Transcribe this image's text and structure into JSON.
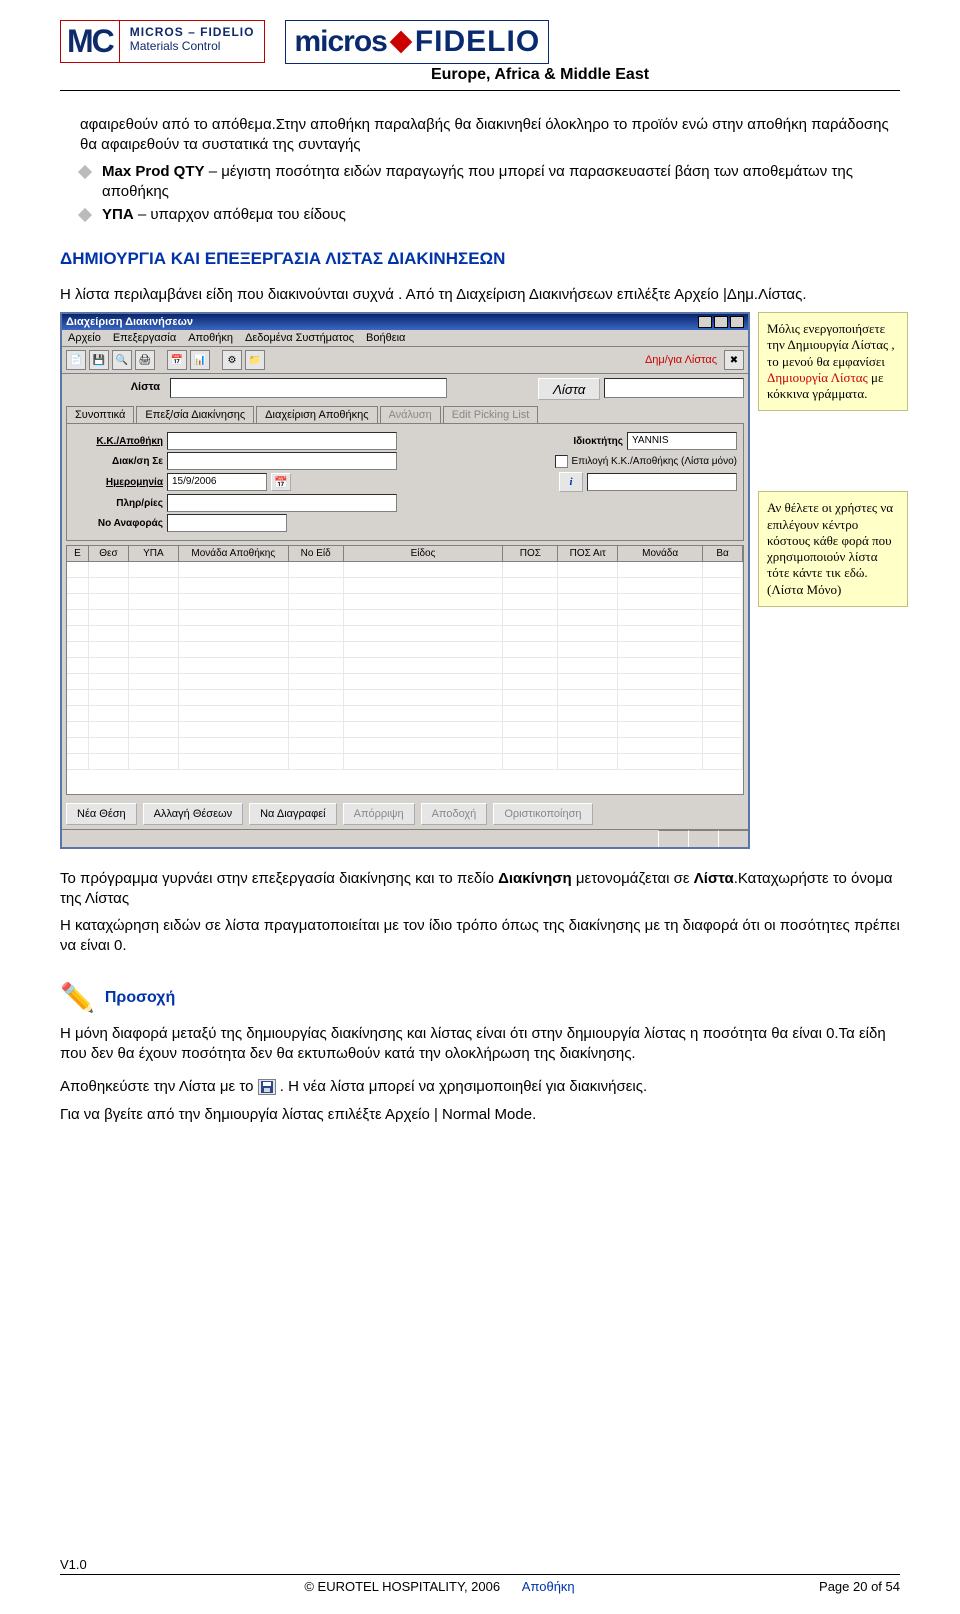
{
  "header": {
    "mc": "MC",
    "mc_line1": "MICROS – FIDELIO",
    "mc_line2": "Materials Control",
    "mf_left": "micros",
    "mf_right": "FIDELIO",
    "subtitle": "Europe, Africa & Middle East"
  },
  "intro_text": "αφαιρεθούν από το απόθεμα.Στην αποθήκη παραλαβής θα διακινηθεί όλοκληρο το προϊόν ενώ στην αποθήκη παράδοσης θα αφαιρεθούν τα συστατικά της συνταγής",
  "bullets": [
    {
      "bold": "Max Prod QTY",
      "rest": " – μέγιστη ποσότητα ειδών παραγωγής που μπορεί να παρασκευαστεί βάση των αποθεμάτων της αποθήκης"
    },
    {
      "bold": "ΥΠΑ",
      "rest": " – υπαρχον απόθεμα του είδους"
    }
  ],
  "section_title": "ΔΗΜΙΟΥΡΓΙΑ ΚΑΙ ΕΠΕΞΕΡΓΑΣΙΑ ΛΙΣΤΑΣ ΔΙΑΚΙΝΗΣΕΩΝ",
  "section_intro": "Η λίστα περιλαμβάνει είδη που διακινούνται συχνά . Από τη Διαχείριση Διακινήσεων επιλέξτε Αρχείο |Δημ.Λίστας.",
  "app": {
    "title": "Διαχείριση Διακινήσεων",
    "menu": [
      "Αρχείο",
      "Επεξεργασία",
      "Αποθήκη",
      "Δεδομένα Συστήματος",
      "Βοήθεια"
    ],
    "red_link": "Δημ/για Λίστας",
    "lista_label": "Λίστα",
    "lista_btn": "Λίστα",
    "tabs": [
      "Συνοπτικά",
      "Επεξ/σία Διακίνησης",
      "Διαχείριση Αποθήκης",
      "Ανάλυση",
      "Edit Picking List"
    ],
    "form": {
      "row1_label": "Κ.Κ./Αποθήκη",
      "row1_right_label": "Ιδιοκτήτης",
      "row1_right_value": "YANNIS",
      "row2_label": "Διακ/ση Σε",
      "row2_check": "Επιλογή Κ.Κ./Αποθήκης (Λίστα μόνο)",
      "row3_label": "Ημερομηνία",
      "row3_value": "15/9/2006",
      "row4_label": "Πληρ/ρίες",
      "row5_label": "Νο Αναφοράς"
    },
    "grid_headers": [
      "Ε",
      "Θεσ",
      "ΥΠΑ",
      "Μονάδα Αποθήκης",
      "Νο Είδ",
      "Είδος",
      "ΠΟΣ",
      "ΠΟΣ Αιτ",
      "Μονάδα",
      "Βα"
    ],
    "footer_buttons": [
      "Νέα Θέση",
      "Αλλαγή Θέσεων",
      "Να Διαγραφεί",
      "Απόρριψη",
      "Αποδοχή",
      "Οριστικοποίηση"
    ]
  },
  "callouts": [
    {
      "pre": "Μόλις ενεργοποιήσετε την Δημιουργία Λίστας , το μενού θα εμφανίσει ",
      "red": "Δημιουργία Λίστας",
      "post": " με κόκκινα γράμματα."
    },
    {
      "pre": "Αν θέλετε οι χρήστες να επιλέγουν κέντρο κόστους κάθε φορά που χρησιμοποιούν λίστα τότε κάντε τικ εδώ. (Λίστα Μόνο)",
      "red": "",
      "post": ""
    }
  ],
  "after1": "Το πρόγραμμα γυρνάει στην επεξεργασία διακίνησης και το πεδίο ",
  "after1_b1": "Διακίνηση",
  "after1_mid": " μετονομάζεται σε ",
  "after1_b2": "Λίστα",
  "after1_end": ".Καταχωρήστε το όνομα της Λίστας",
  "after2": "Η καταχώρηση ειδών σε λίστα πραγματοποιείται με τον ίδιο τρόπο όπως της διακίνησης με τη διαφορά ότι οι ποσότητες πρέπει να είναι 0.",
  "attention_label": "Προσοχή",
  "attention_p1": "Η μόνη διαφορά μεταξύ της δημιουργίας διακίνησης και λίστας είναι ότι στην δημιουργία λίστας η ποσότητα θα είναι 0.Τα είδη που δεν θα έχουν ποσότητα δεν θα εκτυπωθούν κατά την ολοκλήρωση της διακίνησης.",
  "attention_p2a": "Αποθηκεύστε την Λίστα με το ",
  "attention_p2b": ". Η νέα λίστα μπορεί να χρησιμοποιηθεί για διακινήσεις.",
  "attention_p3": "Για να βγείτε από την δημιουργία λίστας επιλέξτε Αρχείο | Normal Mode.",
  "footer": {
    "version": "V1.0",
    "copyright": "© EUROTEL HOSPITALITY, 2006",
    "section": "Αποθήκη",
    "page": "Page 20 of 54"
  }
}
